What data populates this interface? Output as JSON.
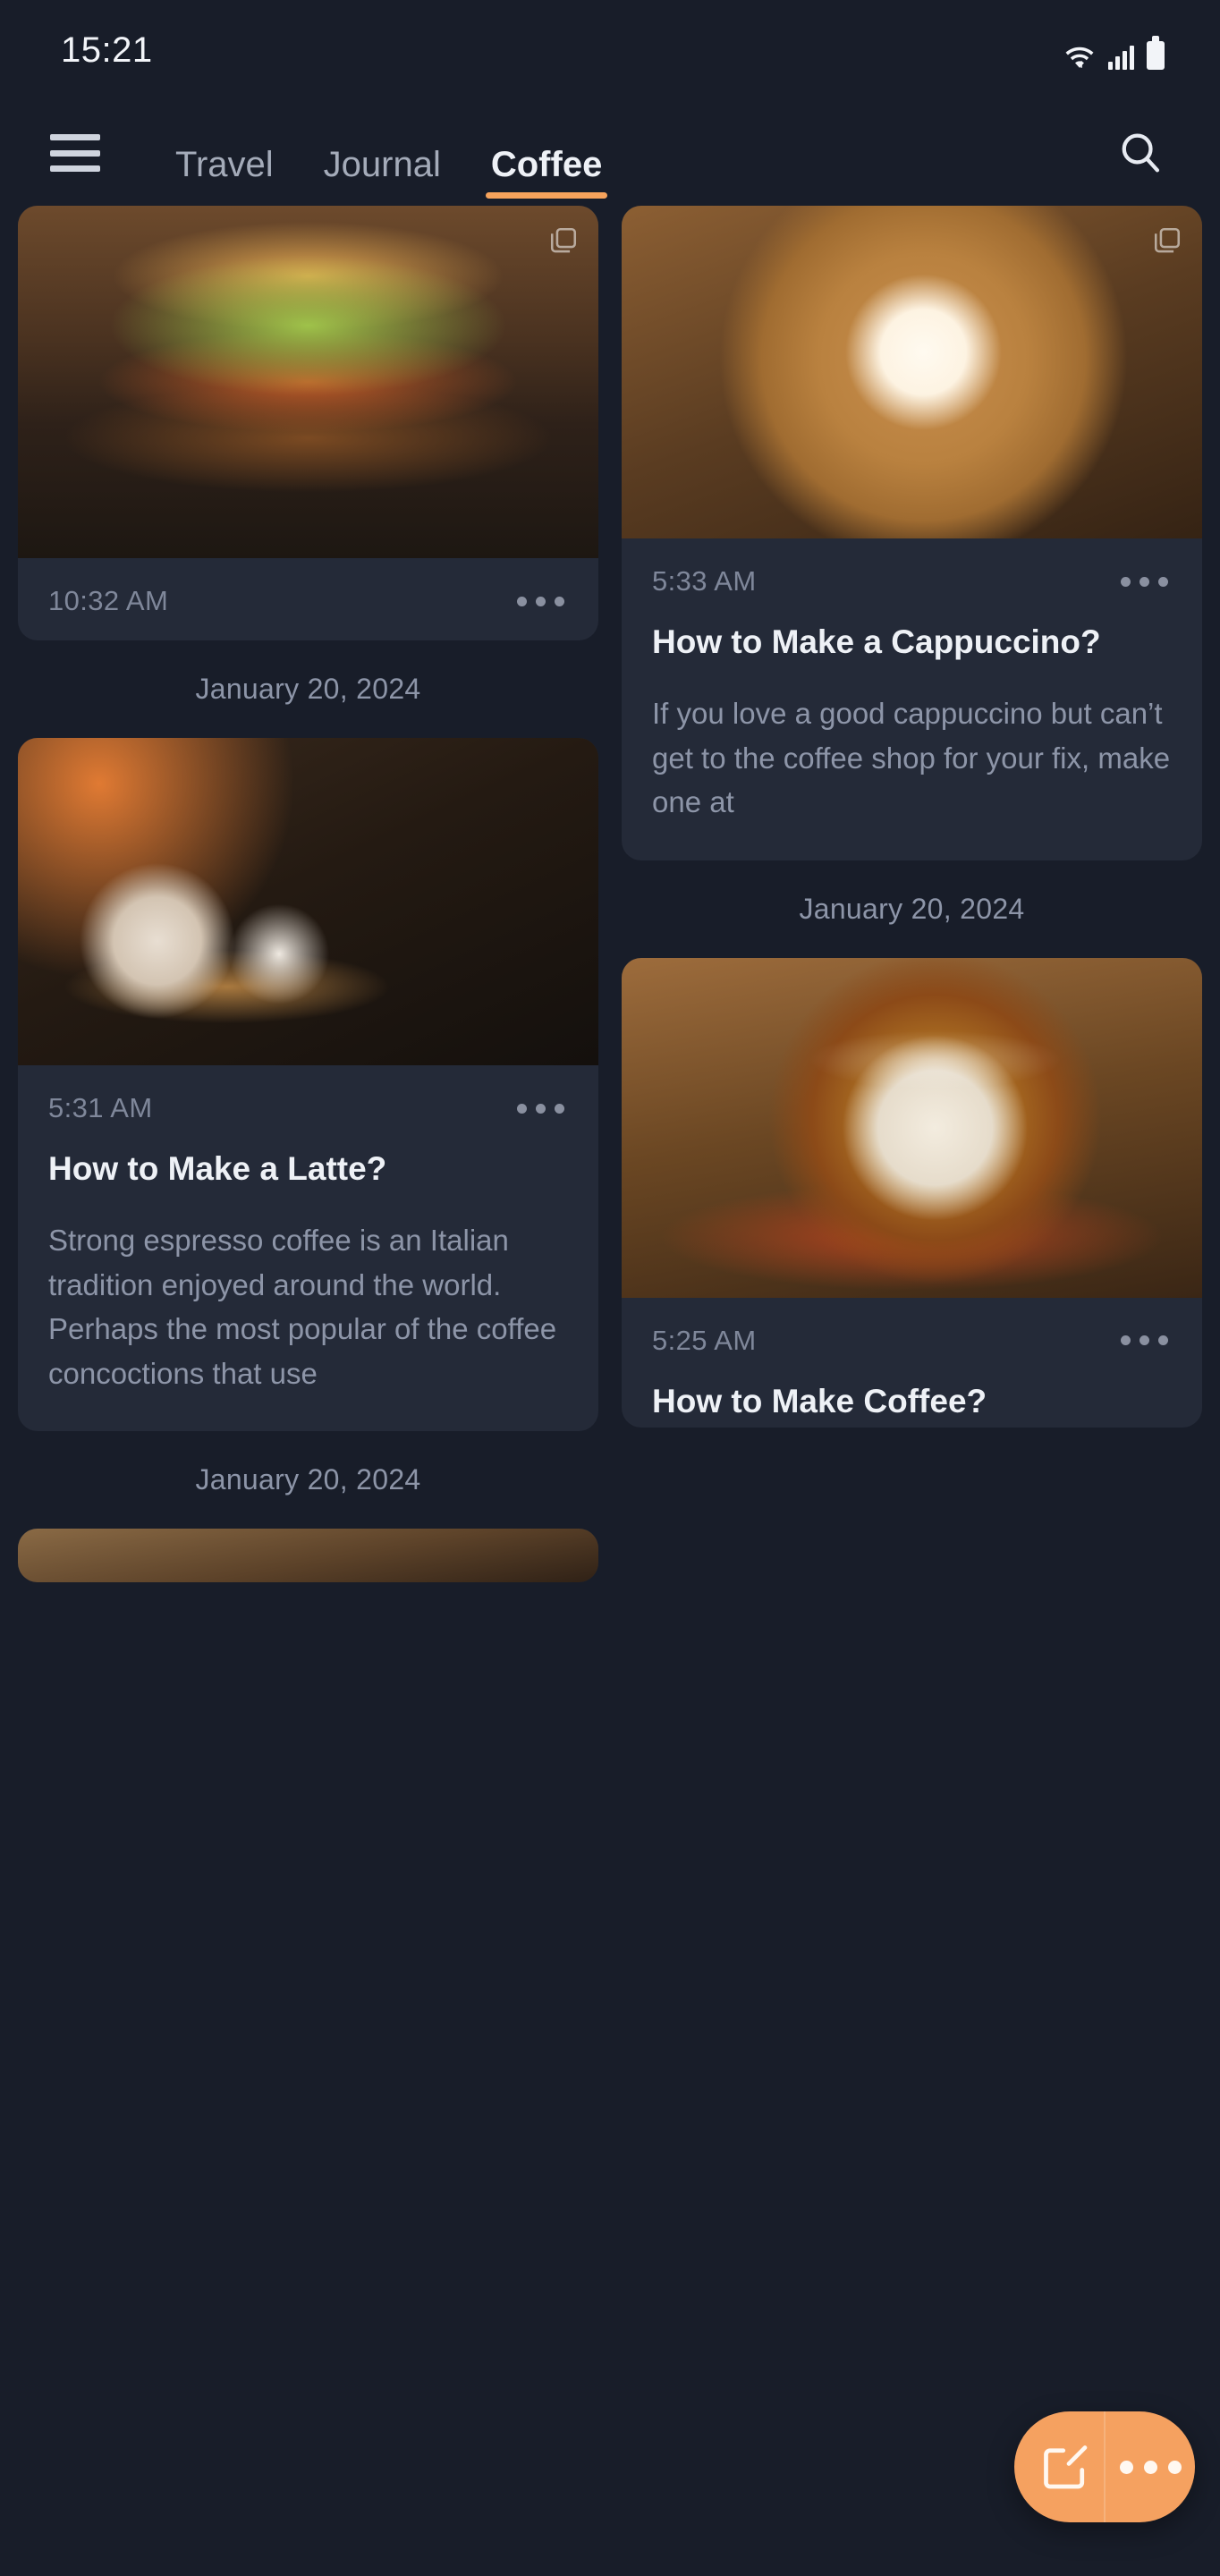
{
  "status_bar": {
    "time": "15:21",
    "icons": [
      "wifi-icon",
      "signal-icon",
      "battery-icon"
    ]
  },
  "top_nav": {
    "menu_icon": "hamburger-menu-icon",
    "search_icon": "search-icon",
    "tabs": [
      {
        "label": "Travel",
        "active": false
      },
      {
        "label": "Journal",
        "active": false
      },
      {
        "label": "Coffee",
        "active": true
      }
    ],
    "active_underline_color": "#f6a35c"
  },
  "theme": {
    "background": "#181d29",
    "card_background": "#242a38",
    "accent": "#f5a160",
    "title_color": "#eef1f6",
    "body_color": "#8d95a8",
    "muted_color": "#7f879a"
  },
  "feed": {
    "left_column": [
      {
        "image_name": "burger-photo",
        "has_stack_icon": true,
        "time": "10:32 AM",
        "menu_icon": "more-options-icon",
        "title": "",
        "body": "",
        "date": "January 20, 2024"
      },
      {
        "image_name": "latte-tray-photo",
        "has_stack_icon": false,
        "time": "5:31 AM",
        "menu_icon": "more-options-icon",
        "title": "How to Make a Latte?",
        "body": "Strong espresso coffee is an Italian tradition enjoyed around the world. Perhaps the most popular of the coffee concoctions that use",
        "date": "January 20, 2024"
      },
      {
        "image_name": "partial-photo",
        "has_stack_icon": false,
        "time": "",
        "menu_icon": "",
        "title": "",
        "body": "",
        "date": ""
      }
    ],
    "right_column": [
      {
        "image_name": "cappuccino-photo",
        "has_stack_icon": true,
        "time": "5:33 AM",
        "menu_icon": "more-options-icon",
        "title": "How to Make a Cappuccino?",
        "body": "If you love a good cappuccino but can’t get to the coffee shop for your fix, make one at",
        "date": "January 20, 2024"
      },
      {
        "image_name": "espresso-cup-photo",
        "has_stack_icon": false,
        "time": "5:25 AM",
        "menu_icon": "more-options-icon",
        "title": "How to Make Coffee?",
        "body": "",
        "date": ""
      }
    ]
  },
  "fab": {
    "compose_icon": "compose-edit-icon",
    "more_icon": "more-options-icon",
    "color": "#f5a160"
  }
}
